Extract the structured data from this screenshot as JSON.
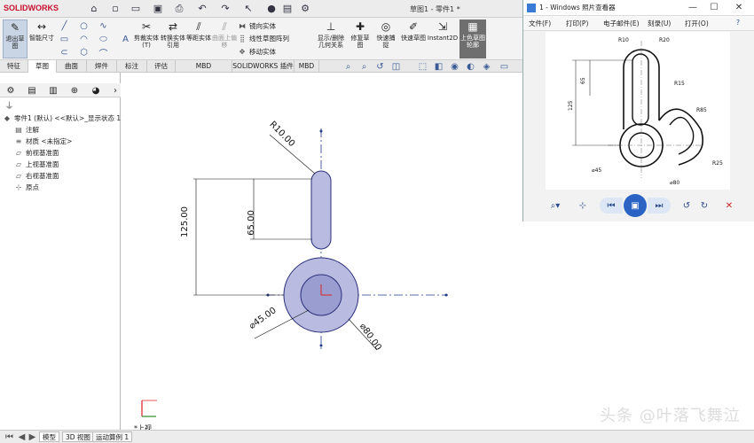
{
  "app": {
    "logo": "SOLIDWORKS",
    "doc_title": "草图1 - 零件1 *"
  },
  "ribbon": {
    "exit_sketch": "退出草图",
    "smart_dimension": "智能尺寸",
    "trim": "剪裁实体(T)",
    "convert": "转换实体引用",
    "offset": "等距实体",
    "surface_offset": "曲面上偏移",
    "mirror": "镜向实体",
    "linear_pattern": "线性草图阵列",
    "move": "移动实体",
    "show_relations": "显示/删除几何关系",
    "repair_sketch": "修复草图",
    "quick_snap": "快速捕捉",
    "rapid_sketch": "快速草图",
    "instant2d": "Instant2D",
    "shaded_sketch": "上色草图轮廓"
  },
  "tabs": [
    "特征",
    "草图",
    "曲面",
    "焊件",
    "标注",
    "评估",
    "MBD Dimensions",
    "SOLIDWORKS 插件",
    "MBD"
  ],
  "selected_tab": "草图",
  "tree": {
    "root": "零件1 (默认) <<默认>_显示状态 1>",
    "items": [
      "注解",
      "材质 <未指定>",
      "前视基准面",
      "上视基准面",
      "右视基准面",
      "原点"
    ]
  },
  "drawing": {
    "dim_r10": "R10.00",
    "dim_125": "125.00",
    "dim_65": "65.00",
    "dim_d45": "⌀45.00",
    "dim_d80": "⌀80.00",
    "view_label": "*上视"
  },
  "status_tabs": [
    "模型",
    "3D 视图",
    "运动算例 1"
  ],
  "viewer": {
    "title": "1 - Windows 照片查看器",
    "menu": [
      "文件(F)",
      "打印(P)",
      "电子邮件(E)",
      "刻录(U)",
      "打开(O)"
    ],
    "minimize": "—",
    "maximize": "☐",
    "close": "✕",
    "image_labels": {
      "r10": "R10",
      "r20": "R20",
      "d65": "65",
      "d125": "125",
      "d45": "⌀45",
      "d80": "⌀80",
      "r85": "R85",
      "r15": "R15",
      "r25": "R25"
    }
  },
  "watermark": "头条 @叶落飞舞泣"
}
